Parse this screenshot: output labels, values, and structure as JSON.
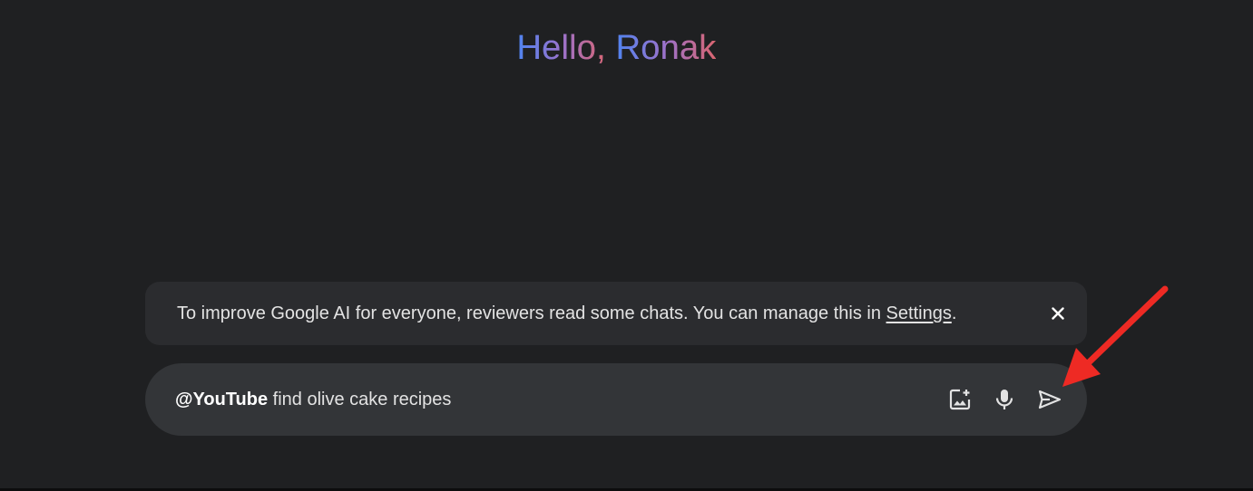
{
  "greeting": {
    "prefix": "Hello,",
    "name": "Ronak"
  },
  "notice": {
    "text": "To improve Google AI for everyone, reviewers read some chats. You can manage this in ",
    "link_label": "Settings",
    "suffix": ".",
    "close_icon": "close-icon"
  },
  "prompt": {
    "mention": "@YouTube",
    "text": " find olive cake recipes",
    "actions": [
      {
        "name": "add-image-button",
        "icon": "add-image-icon"
      },
      {
        "name": "microphone-button",
        "icon": "microphone-icon"
      },
      {
        "name": "send-button",
        "icon": "send-icon"
      }
    ]
  },
  "annotation": {
    "arrow_color": "#ee2a24"
  },
  "colors": {
    "background": "#1f2022",
    "surface": "#2b2c2f",
    "input_surface": "#333538",
    "text": "#e3e3e3",
    "gradient": [
      "#4f84f0",
      "#9b72cb",
      "#d96570"
    ]
  }
}
